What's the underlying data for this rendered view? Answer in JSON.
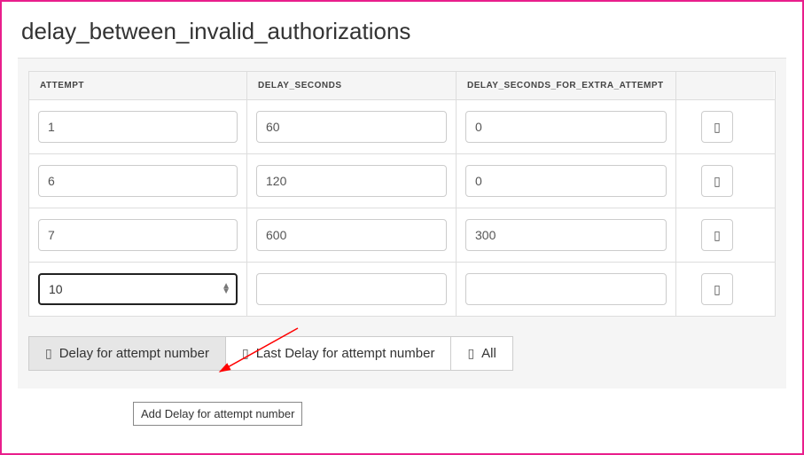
{
  "title": "delay_between_invalid_authorizations",
  "columns": {
    "attempt": "ATTEMPT",
    "delay_seconds": "DELAY_SECONDS",
    "delay_seconds_extra": "DELAY_SECONDS_FOR_EXTRA_ATTEMPT"
  },
  "rows": [
    {
      "attempt": "1",
      "delay_seconds": "60",
      "delay_seconds_extra": "0",
      "focused": false
    },
    {
      "attempt": "6",
      "delay_seconds": "120",
      "delay_seconds_extra": "0",
      "focused": false
    },
    {
      "attempt": "7",
      "delay_seconds": "600",
      "delay_seconds_extra": "300",
      "focused": false
    },
    {
      "attempt": "10",
      "delay_seconds": "",
      "delay_seconds_extra": "",
      "focused": true
    }
  ],
  "row_action_icon": "trash-icon",
  "buttons": {
    "delay_for_attempt": "Delay for attempt number",
    "last_delay_for_attempt": "Last Delay for attempt number",
    "all": "All"
  },
  "tooltip": "Add Delay for attempt number"
}
